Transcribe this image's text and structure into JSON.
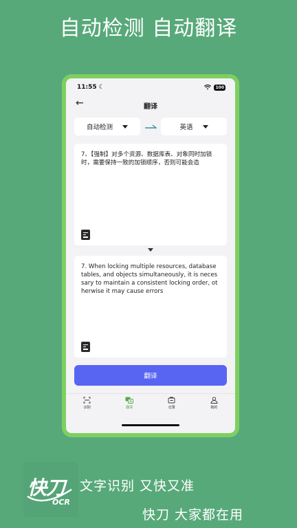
{
  "promo": {
    "headline": "自动检测 自动翻译",
    "tagline_1": "文字识别 又快又准",
    "tagline_2": "快刀 大家都在用",
    "logo_main": "快刀",
    "logo_sub": "OCR"
  },
  "status_bar": {
    "time": "11:55",
    "battery": "100"
  },
  "nav": {
    "title": "翻译"
  },
  "languages": {
    "source": "自动检测",
    "target": "英语"
  },
  "source_text": "7、【强制】对多个资源、数据库表、对象同时加锁时，需要保持一致的加锁顺序，否则可能会造",
  "translated_text": "7. When locking multiple resources, database tables, and objects simultaneously, it is necessary to maintain a consistent locking order, otherwise it may cause errors",
  "translate_button": "翻译",
  "tabs": [
    {
      "label": "识别",
      "icon": "scan-icon"
    },
    {
      "label": "翻译",
      "icon": "translate-icon"
    },
    {
      "label": "记录",
      "icon": "record-icon"
    },
    {
      "label": "我的",
      "icon": "profile-icon"
    }
  ],
  "colors": {
    "background": "#58a97a",
    "frame": "#7ecf60",
    "accent_button": "#5865f2",
    "active_tab": "#5aa84a"
  }
}
